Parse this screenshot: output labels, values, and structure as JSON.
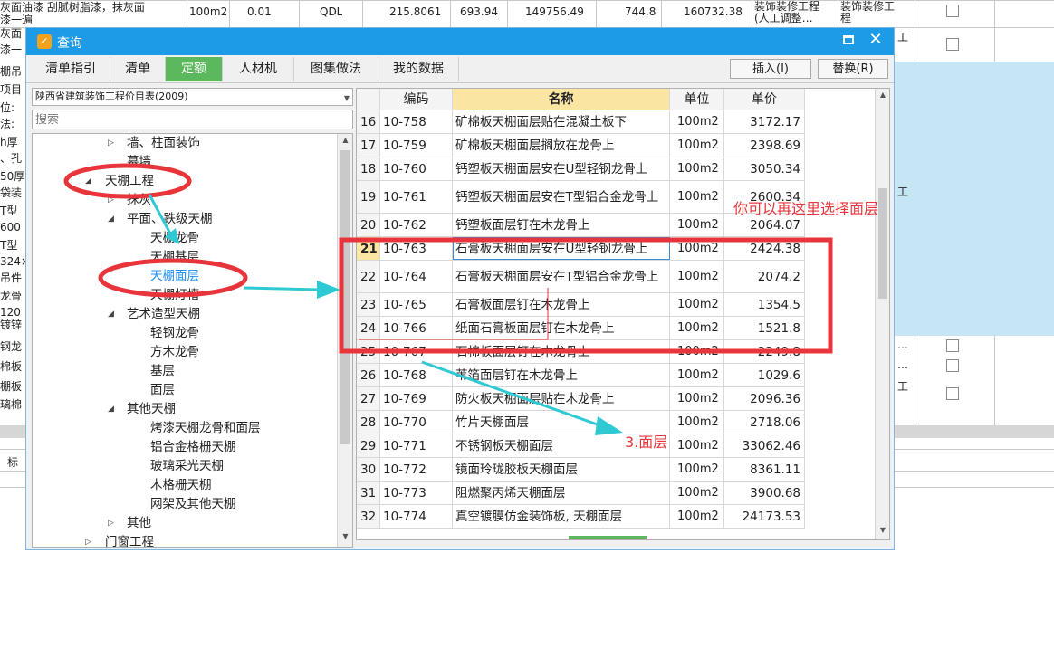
{
  "background": {
    "row1": {
      "c0": "灰面油漆 刮腻树脂漆，抹灰面",
      "c0b": "漆一遍",
      "unit": "100m2",
      "qty": "0.01",
      "code": "QDL",
      "v1": "215.8061",
      "v2": "693.94",
      "v3": "149756.49",
      "v4": "744.8",
      "v5": "160732.38",
      "cat": "装饰装修工程",
      "cat2": "(人工调整…",
      "cat3": "装饰装修工",
      "cat3b": "程"
    },
    "left_fragments": [
      "灰面",
      "漆一",
      "棚吊",
      "项目",
      "位:",
      "法:",
      "h厚",
      "、孔",
      "50厚",
      "袋装",
      "T型",
      "600",
      "T型",
      "324×",
      "吊件",
      "龙骨",
      "120",
      "镀锌",
      "钢龙",
      "棉板",
      "棚板",
      "璃棉",
      "标"
    ],
    "right_fragments": [
      "工",
      "工",
      "…",
      "…",
      "工"
    ]
  },
  "dialog": {
    "title": "查询",
    "tabs": [
      "清单指引",
      "清单",
      "定额",
      "人材机",
      "图集做法",
      "我的数据"
    ],
    "active_tab": "定额",
    "insert_button": "插入(I)",
    "replace_button": "替换(R)",
    "combo_value": "陕西省建筑装饰工程价目表(2009)",
    "search_placeholder": "搜索"
  },
  "tree": [
    {
      "label": "墙、柱面装饰",
      "state": "collapsed",
      "level": 2
    },
    {
      "label": "幕墙",
      "state": "none",
      "level": 2
    },
    {
      "label": "天棚工程",
      "state": "expanded",
      "level": 1
    },
    {
      "label": "抹灰",
      "state": "collapsed",
      "level": 2
    },
    {
      "label": "平面、跌级天棚",
      "state": "expanded",
      "level": 2
    },
    {
      "label": "天棚龙骨",
      "state": "none",
      "level": 3
    },
    {
      "label": "天棚基层",
      "state": "none",
      "level": 3
    },
    {
      "label": "天棚面层",
      "state": "selected",
      "level": 3
    },
    {
      "label": "天棚灯槽",
      "state": "none",
      "level": 3
    },
    {
      "label": "艺术造型天棚",
      "state": "expanded",
      "level": 2
    },
    {
      "label": "轻钢龙骨",
      "state": "none",
      "level": 3
    },
    {
      "label": "方木龙骨",
      "state": "none",
      "level": 3
    },
    {
      "label": "基层",
      "state": "none",
      "level": 3
    },
    {
      "label": "面层",
      "state": "none",
      "level": 3
    },
    {
      "label": "其他天棚",
      "state": "expanded",
      "level": 2
    },
    {
      "label": "烤漆天棚龙骨和面层",
      "state": "none",
      "level": 3
    },
    {
      "label": "铝合金格栅天棚",
      "state": "none",
      "level": 3
    },
    {
      "label": "玻璃采光天棚",
      "state": "none",
      "level": 3
    },
    {
      "label": "木格栅天棚",
      "state": "none",
      "level": 3
    },
    {
      "label": "网架及其他天棚",
      "state": "none",
      "level": 3
    },
    {
      "label": "其他",
      "state": "collapsed",
      "level": 2
    },
    {
      "label": "门窗工程",
      "state": "collapsed",
      "level": 1
    }
  ],
  "grid": {
    "headers": [
      "编码",
      "名称",
      "单位",
      "单价"
    ],
    "rows": [
      {
        "n": "16",
        "code": "10-758",
        "name": "矿棉板天棚面层贴在混凝土板下",
        "unit": "100m2",
        "price": "3172.17"
      },
      {
        "n": "17",
        "code": "10-759",
        "name": "矿棉板天棚面层搁放在龙骨上",
        "unit": "100m2",
        "price": "2398.69"
      },
      {
        "n": "18",
        "code": "10-760",
        "name": "钙塑板天棚面层安在U型轻钢龙骨上",
        "unit": "100m2",
        "price": "3050.34"
      },
      {
        "n": "19",
        "code": "10-761",
        "name": "钙塑板天棚面层安在T型铝合金龙骨上",
        "unit": "100m2",
        "price": "2600.34"
      },
      {
        "n": "20",
        "code": "10-762",
        "name": "钙塑板面层钉在木龙骨上",
        "unit": "100m2",
        "price": "2064.07"
      },
      {
        "n": "21",
        "code": "10-763",
        "name": "石膏板天棚面层安在U型轻钢龙骨上",
        "unit": "100m2",
        "price": "2424.38"
      },
      {
        "n": "22",
        "code": "10-764",
        "name": "石膏板天棚面层安在T型铝合金龙骨上",
        "unit": "100m2",
        "price": "2074.2"
      },
      {
        "n": "23",
        "code": "10-765",
        "name": "石膏板面层钉在木龙骨上",
        "unit": "100m2",
        "price": "1354.5"
      },
      {
        "n": "24",
        "code": "10-766",
        "name": "纸面石膏板面层钉在木龙骨上",
        "unit": "100m2",
        "price": "1521.8"
      },
      {
        "n": "25",
        "code": "10-767",
        "name": "石棉板面层钉在木龙骨上",
        "unit": "100m2",
        "price": "2249.8"
      },
      {
        "n": "26",
        "code": "10-768",
        "name": "苇箔面层钉在木龙骨上",
        "unit": "100m2",
        "price": "1029.6"
      },
      {
        "n": "27",
        "code": "10-769",
        "name": "防火板天棚面层贴在木龙骨上",
        "unit": "100m2",
        "price": "2096.36"
      },
      {
        "n": "28",
        "code": "10-770",
        "name": "竹片天棚面层",
        "unit": "100m2",
        "price": "2718.06"
      },
      {
        "n": "29",
        "code": "10-771",
        "name": "不锈钢板天棚面层",
        "unit": "100m2",
        "price": "33062.46"
      },
      {
        "n": "30",
        "code": "10-772",
        "name": "镜面玲珑胶板天棚面层",
        "unit": "100m2",
        "price": "8361.11"
      },
      {
        "n": "31",
        "code": "10-773",
        "name": "阻燃聚丙烯天棚面层",
        "unit": "100m2",
        "price": "3900.68"
      },
      {
        "n": "32",
        "code": "10-774",
        "name": "真空镀膜仿金装饰板, 天棚面层",
        "unit": "100m2",
        "price": "24173.53"
      }
    ],
    "current_row": "21"
  },
  "annotations": {
    "note": "你可以再这里选择面层",
    "step": "3.面层",
    "color": "#e8353b",
    "arrow_color": "#2ec9d3"
  }
}
